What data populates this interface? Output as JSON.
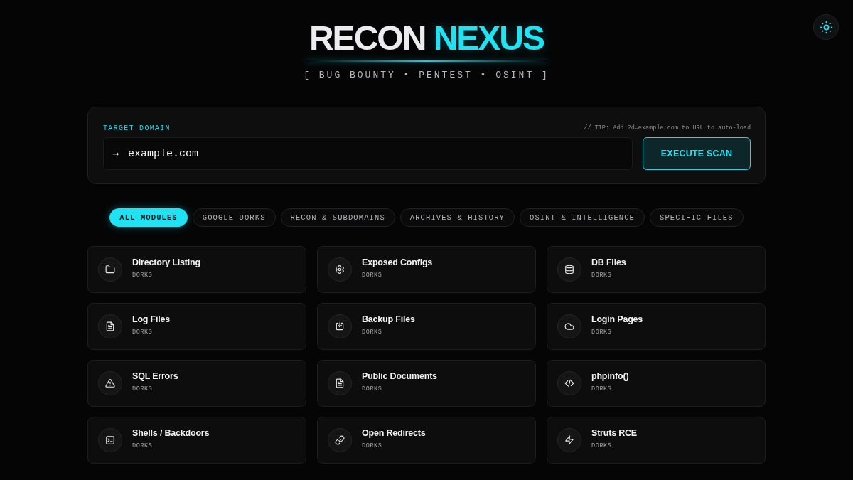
{
  "header": {
    "title_parts": [
      {
        "text": "RECON",
        "kind": "plain"
      },
      {
        "text": "NEXUS",
        "kind": "accent"
      }
    ],
    "tagline": "[ BUG BOUNTY • PENTEST • OSINT ]"
  },
  "target": {
    "label": "TARGET DOMAIN",
    "tip": "// TIP: Add ?d=example.com to URL to auto-load",
    "prompt": "→",
    "value": "example.com",
    "button": "EXECUTE SCAN"
  },
  "tabs": [
    {
      "label": "ALL MODULES",
      "selected": true
    },
    {
      "label": "GOOGLE DORKS",
      "selected": false
    },
    {
      "label": "RECON & SUBDOMAINS",
      "selected": false
    },
    {
      "label": "ARCHIVES & HISTORY",
      "selected": false
    },
    {
      "label": "OSINT & INTELLIGENCE",
      "selected": false
    },
    {
      "label": "SPECIFIC FILES",
      "selected": false
    }
  ],
  "modules": [
    {
      "title": "Directory Listing",
      "tag": "DORKS"
    },
    {
      "title": "Exposed Configs",
      "tag": "DORKS"
    },
    {
      "title": "DB Files",
      "tag": "DORKS"
    },
    {
      "title": "Log Files",
      "tag": "DORKS"
    },
    {
      "title": "Backup Files",
      "tag": "DORKS"
    },
    {
      "title": "Login Pages",
      "tag": "DORKS"
    },
    {
      "title": "SQL Errors",
      "tag": "DORKS"
    },
    {
      "title": "Public Documents",
      "tag": "DORKS"
    },
    {
      "title": "phpinfo()",
      "tag": "DORKS"
    },
    {
      "title": "Shells / Backdoors",
      "tag": "DORKS"
    },
    {
      "title": "Open Redirects",
      "tag": "DORKS"
    },
    {
      "title": "Struts RCE",
      "tag": "DORKS"
    }
  ]
}
